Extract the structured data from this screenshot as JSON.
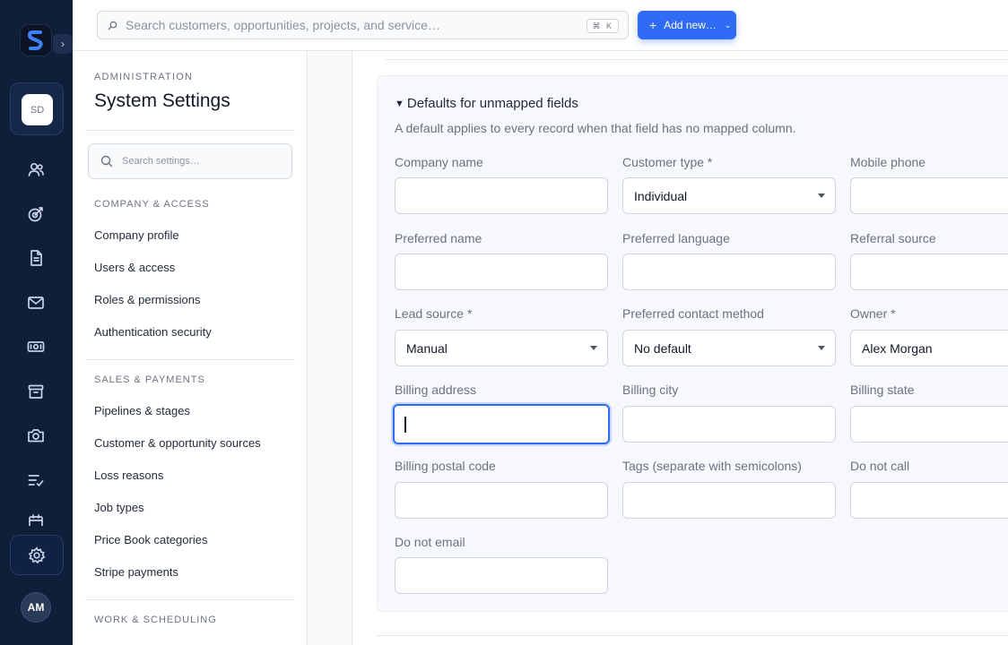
{
  "rail": {
    "workspace_badge": "SD",
    "avatar": "AM",
    "toggle": "›",
    "icons": [
      "users-icon",
      "target-icon",
      "document-icon",
      "mail-icon",
      "money-icon",
      "archive-icon",
      "camera-icon",
      "checklist-icon",
      "calendar-icon",
      "gear-icon"
    ]
  },
  "topbar": {
    "search_placeholder": "Search customers, opportunities, projects, and service…",
    "shortcut": "⌘ K",
    "add_label": "Add new…",
    "add_plus": "+",
    "add_chevron": "⌄"
  },
  "sidebar": {
    "eyebrow": "ADMINISTRATION",
    "title": "System Settings",
    "search_placeholder": "Search settings…",
    "sections": [
      {
        "label": "COMPANY & ACCESS",
        "items": [
          "Company profile",
          "Users & access",
          "Roles & permissions",
          "Authentication security"
        ]
      },
      {
        "label": "SALES & PAYMENTS",
        "items": [
          "Pipelines & stages",
          "Customer & opportunity sources",
          "Loss reasons",
          "Job types",
          "Price Book categories",
          "Stripe payments"
        ]
      },
      {
        "label": "WORK & SCHEDULING",
        "items": []
      }
    ]
  },
  "panel": {
    "caret": "▼",
    "title": "Defaults for unmapped fields",
    "description": "A default applies to every record when that field has no mapped column.",
    "fields": [
      {
        "label": "Company name",
        "value": ""
      },
      {
        "label": "Customer type *",
        "value": "Individual",
        "select": true
      },
      {
        "label": "Mobile phone",
        "value": ""
      },
      {
        "label": "Preferred name",
        "value": ""
      },
      {
        "label": "Preferred language",
        "value": ""
      },
      {
        "label": "Referral source",
        "value": ""
      },
      {
        "label": "Lead source *",
        "value": "Manual",
        "select": true
      },
      {
        "label": "Preferred contact method",
        "value": "No default",
        "select": true
      },
      {
        "label": "Owner *",
        "value": "Alex Morgan"
      },
      {
        "label": "Billing address",
        "value": "",
        "focused": true
      },
      {
        "label": "Billing city",
        "value": ""
      },
      {
        "label": "Billing state",
        "value": ""
      },
      {
        "label": "Billing postal code",
        "value": ""
      },
      {
        "label": "Tags (separate with semicolons)",
        "value": ""
      },
      {
        "label": "Do not call",
        "value": ""
      },
      {
        "label": "Do not email",
        "value": ""
      }
    ]
  },
  "colors": {
    "rail": "#0f1f3a",
    "accent": "#2f6bf5",
    "panel": "#f6f8fc"
  }
}
